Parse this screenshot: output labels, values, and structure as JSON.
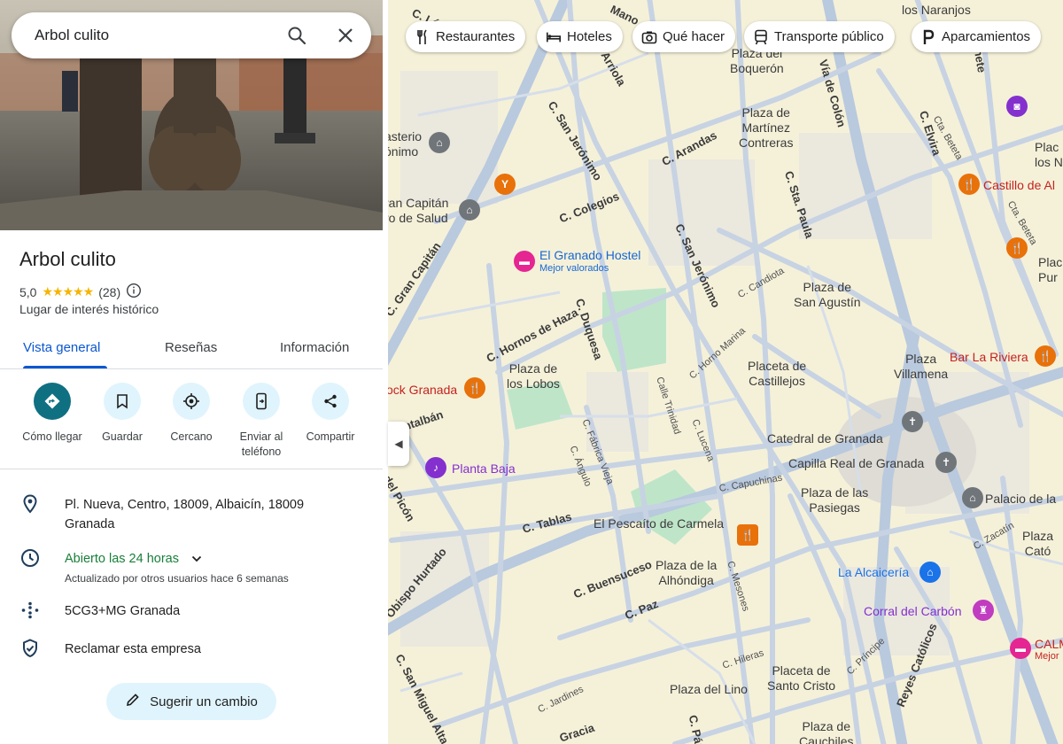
{
  "search": {
    "query": "Arbol culito"
  },
  "place": {
    "name": "Arbol culito",
    "rating": "5,0",
    "stars": "★★★★★",
    "review_count": "(28)",
    "category": "Lugar de interés histórico"
  },
  "tabs": [
    {
      "label": "Vista general",
      "active": true
    },
    {
      "label": "Reseñas"
    },
    {
      "label": "Información"
    }
  ],
  "actions": [
    {
      "label": "Cómo llegar",
      "icon": "directions-icon"
    },
    {
      "label": "Guardar",
      "icon": "bookmark-icon"
    },
    {
      "label": "Cercano",
      "icon": "nearby-icon"
    },
    {
      "label": "Enviar al teléfono",
      "icon": "send-to-phone-icon"
    },
    {
      "label": "Compartir",
      "icon": "share-icon"
    }
  ],
  "info": {
    "address": "Pl. Nueva, Centro, 18009, Albaicín, 18009 Granada",
    "hours": "Abierto las 24 horas",
    "hours_note": "Actualizado por otros usuarios hace 6 semanas",
    "plus_code": "5CG3+MG Granada",
    "claim": "Reclamar esta empresa"
  },
  "suggest_label": "Sugerir un cambio",
  "map": {
    "chips": [
      "Restaurantes",
      "Hoteles",
      "Qué hacer",
      "Transporte público",
      "Aparcamientos"
    ],
    "streets": {
      "s1": "C. San Jerónimo",
      "s2": "C. Colegios",
      "s3": "C. Arandas",
      "s4": "C. Gran Capitán",
      "s5": "C. Hornos de Haza",
      "s6": "C. Duquesa",
      "s7": "C. San Jerónimo",
      "s8": "Vía de Colón",
      "s9": "C. Sta. Paula",
      "s10": "C. Elvira",
      "s11": "C. Tablas",
      "s12": "C. Buensuceso",
      "s13": "C. Paz",
      "s14": "Obispo Hurtado",
      "s15": "C. San Miguel Alta",
      "s16": "Reyes Católicos",
      "s17": "C. Fábrica Vieja",
      "s18": "C. Ángulo",
      "s19": "C. Lucena",
      "s20": "Calle Trinidad",
      "s21": "C. Capuchinas",
      "s22": "C. Mesones",
      "s23": "C. Hileras",
      "s24": "C. Jardines",
      "s25": "C. Candiota",
      "s26": "C. Horno Marina",
      "s27": "C. Zacatín",
      "s28": "C. Príncipe",
      "s29": "Cta. Beteta",
      "s30": "Cta. Beteta",
      "s31": "C. Párr",
      "s32": "Gracia",
      "s33": "Montalbán",
      "s34": "del Picón",
      "s35": "C. López",
      "s36": "Mano",
      "s37": "Arriola",
      "s38": "nete"
    },
    "places": {
      "p1": "Plaza del\nBoquerón",
      "p2": "Plaza de\nMartínez\nContreras",
      "p3": "Plaza de\nSan Agustín",
      "p4": "Placeta de\nCastillejos",
      "p5": "Plaza\nVillamena",
      "p6": "Plaza de\nlos Lobos",
      "p7": "Plaza de las\nPasiegas",
      "p8": "Plaza de la\nAlhóndiga",
      "p9": "Plaza del Lino",
      "p10": "Placeta de\nSanto Cristo",
      "p11": "Plaza de\nCauchiles",
      "p12": "Plaza\nCató",
      "p13": "los Naranjos",
      "p14": "asterio\nónimo",
      "p15": "ran Capitán\nro de Salud",
      "p16": "Plac\nlos N",
      "p17": "Plac\nPur"
    },
    "pois": {
      "hostel": "El Granado Hostel",
      "hostel_sub": "Mejor valorados",
      "rock": "ock Granada",
      "planta": "Planta Baja",
      "pescaito": "El Pescaíto de Carmela",
      "catedral": "Catedral de Granada",
      "capilla": "Capilla Real de Granada",
      "palacio": "Palacio de la",
      "alcaiceria": "La Alcaicería",
      "corral": "Corral del Carbón",
      "castillo": "Castillo de Al",
      "riviera": "Bar La Riviera",
      "calm": "CALM",
      "calm_sub": "Mejor"
    }
  },
  "colors": {
    "accent": "#0b57d0",
    "primary_action": "#0f7082",
    "action_bg": "#e0f4fd",
    "star": "#f6b400",
    "open_green": "#188038",
    "restaurant_pin": "#e8710a",
    "hotel_pin": "#e52592",
    "attraction_pin": "#8430ce",
    "religious_pin": "#70757a"
  }
}
